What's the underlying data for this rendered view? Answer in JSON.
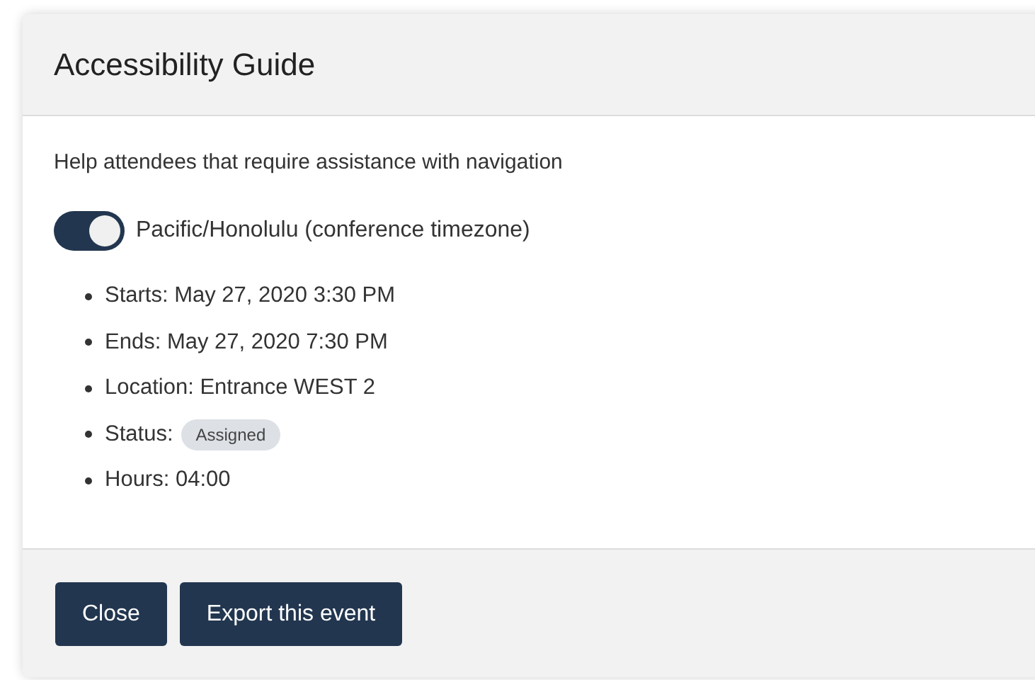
{
  "dialog": {
    "title": "Accessibility Guide",
    "description": "Help attendees that require assistance with navigation",
    "timezone_toggle": {
      "label": "Pacific/Honolulu (conference timezone)",
      "on": true
    },
    "details": [
      {
        "kind": "text",
        "text": "Starts: May 27, 2020 3:30 PM"
      },
      {
        "kind": "text",
        "text": "Ends: May 27, 2020 7:30 PM"
      },
      {
        "kind": "text",
        "text": "Location: Entrance WEST 2"
      },
      {
        "kind": "badge",
        "text": "Status:",
        "badge": "Assigned"
      },
      {
        "kind": "text",
        "text": "Hours: 04:00"
      }
    ],
    "buttons": [
      "Close",
      "Export this event"
    ]
  }
}
